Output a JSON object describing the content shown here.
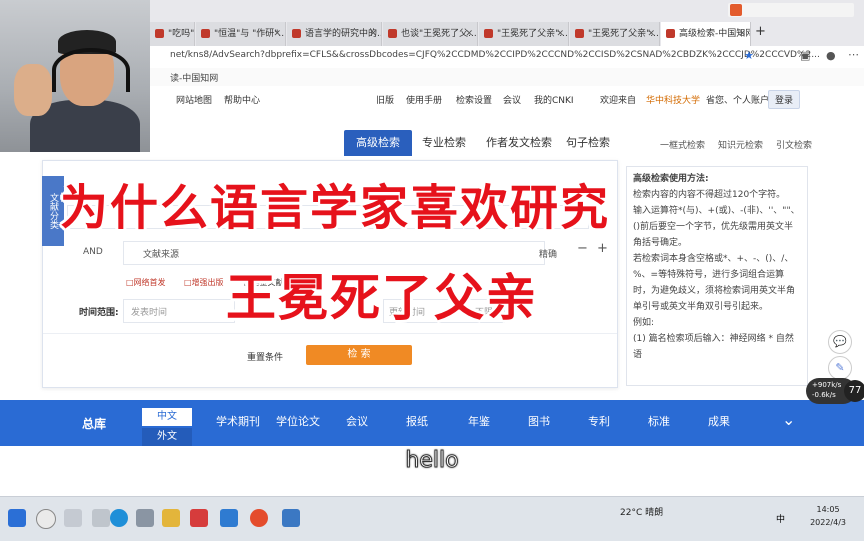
{
  "browser": {
    "tabs": [
      {
        "label": "\"吃吗\"与 \"作职\"..."
      },
      {
        "label": "\"恒温\"与 \"作研\"..."
      },
      {
        "label": "语言学的研究中的..."
      },
      {
        "label": "也谈\"王冕死了父..."
      },
      {
        "label": "\"王冕死了父亲\"..."
      },
      {
        "label": "\"王冕死了父亲\"..."
      },
      {
        "label": "高级检索-中国知网",
        "active": true
      }
    ],
    "url": "net/kns8/AdvSearch?dbprefix=CFLS&&crossDbcodes=CJFQ%2CCDMD%2CCIPD%2CCCND%2CCISD%2CSNAD%2CBDZK%2CCCJD%2CCCVD%2...",
    "bookmark": "读-中国知网"
  },
  "sitenav": {
    "links": [
      "网站地图",
      "帮助中心",
      "旧版",
      "使用手册",
      "检索设置",
      "会议",
      "我的CNKI",
      "欢迎来自",
      "华中科技大学",
      "省您、个人账户"
    ],
    "login": "登录"
  },
  "search_tabs": [
    {
      "label": "高级检索",
      "active": true
    },
    {
      "label": "专业检索"
    },
    {
      "label": "作者发文检索"
    },
    {
      "label": "句子检索"
    }
  ],
  "right_links": [
    "一框式检索",
    "知识元检索",
    "引文检索"
  ],
  "form": {
    "category_tab": "文献分类",
    "row_operator": "AND",
    "row_field": "文献来源",
    "row_match": "精确",
    "checkboxes": [
      "网络首发",
      "增强出版",
      "基金文献",
      "中英文扩展",
      "同义词扩展"
    ],
    "time_label": "时间范围:",
    "time_start": "发表时间",
    "time_end": "更新时间",
    "time_type": "不限",
    "reset": "重置条件",
    "search": "检 索"
  },
  "help": {
    "lines": [
      "高级检索使用方法:",
      "检索内容的内容不得超过120个字符。",
      "输入运算符*(与)、+(或)、-(非)、''、\"\"、()前后要空一个字节，优先级需用英文半角括号确定。",
      "若检索词本身含空格或*、+、-、()、/、%、=等特殊符号，进行多词组合运算时，为避免歧义，须将检索词用英文半角单引号或英文半角双引号引起来。",
      "例如:",
      "(1) 篇名检索项后输入：神经网络 * 自然语"
    ]
  },
  "dbnav": {
    "zongku": "总库",
    "lang_cn": "中文",
    "lang_en": "外文",
    "items": [
      "学术期刊",
      "学位论文",
      "会议",
      "报纸",
      "年鉴",
      "图书",
      "专利",
      "标准",
      "成果"
    ]
  },
  "overlay": {
    "line1": "为什么语言学家喜欢研究",
    "line2": "王冕死了父亲"
  },
  "subtitle": "hello",
  "taskbar": {
    "weather": "22°C 晴朗",
    "time": "14:05",
    "date": "2022/4/3",
    "ime": "中"
  },
  "widgets": {
    "net_up": "+907k/s",
    "net_down": "-0.6k/s",
    "net_value": "77"
  },
  "colors": {
    "title_red": "#e6121b",
    "cnki_blue": "#2a6bd4",
    "search_orange": "#f08a24"
  }
}
